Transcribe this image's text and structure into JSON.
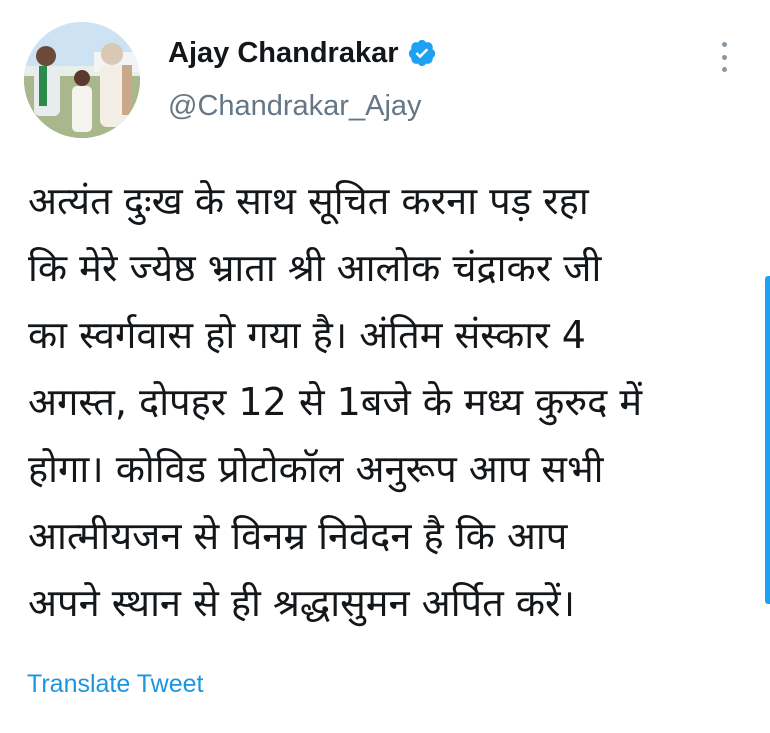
{
  "author": {
    "display_name": "Ajay Chandrakar",
    "handle": "@Chandrakar_Ajay",
    "verified_icon": "verified-badge-icon",
    "avatar_icon": "profile-photo"
  },
  "tweet": {
    "lines": [
      "अत्यंत दुःख के साथ सूचित करना पड़ रहा",
      "कि मेरे ज्येष्ठ भ्राता श्री आलोक चंद्राकर जी",
      "का स्वर्गवास हो गया है। अंतिम संस्कार 4",
      "अगस्त, दोपहर 12 से 1बजे के मध्य कुरुद में",
      "होगा। कोविड प्रोटोकॉल अनुरूप आप सभी",
      "आत्मीयजन से विनम्र निवेदन है कि आप",
      "अपने स्थान से ही श्रद्धासुमन अर्पित करें।"
    ]
  },
  "actions": {
    "translate_label": "Translate Tweet",
    "more_icon": "more-vertical-icon"
  },
  "colors": {
    "accent": "#1da1f2",
    "link": "#1b95e0",
    "secondary_text": "#657786",
    "primary_text": "#14171a"
  }
}
